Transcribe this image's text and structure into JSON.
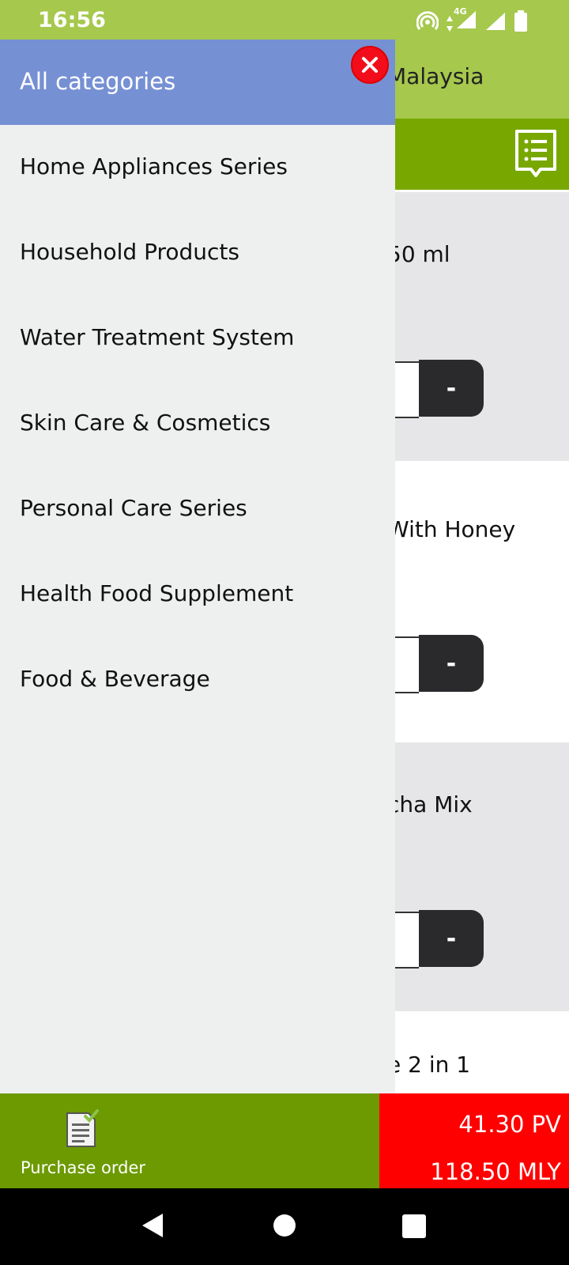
{
  "status_bar": {
    "time": "16:56",
    "network_label": "4G"
  },
  "app": {
    "header_title": "Malaysia",
    "products": [
      {
        "name": "50 ml"
      },
      {
        "name": "With Honey"
      },
      {
        "name": "cha Mix"
      },
      {
        "name": "e 2 in 1"
      }
    ],
    "minus_label": "-"
  },
  "drawer": {
    "title": "All categories",
    "categories": [
      "Home Appliances Series",
      "Household Products",
      "Water Treatment System",
      "Skin Care & Cosmetics",
      "Personal Care Series",
      "Health Food Supplement",
      "Food & Beverage"
    ]
  },
  "bottom_bar": {
    "purchase_order_label": "Purchase order",
    "pv": "41.30 PV",
    "mly": "118.50 MLY"
  },
  "colors": {
    "status_green": "#a6c84d",
    "toolbar_green": "#78a800",
    "bottom_green": "#6c9a00",
    "drawer_header": "#7690d4",
    "close_red": "#f30d1b",
    "total_red": "#ff0000"
  }
}
